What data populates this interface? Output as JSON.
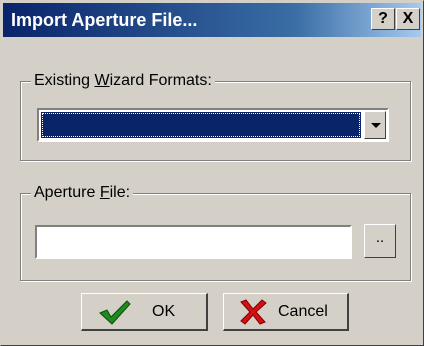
{
  "window": {
    "title": "Import Aperture File...",
    "help_glyph": "?",
    "close_glyph": "X"
  },
  "wizard_group": {
    "legend_prefix": "Existing ",
    "legend_accel": "W",
    "legend_suffix": "izard Formats:",
    "selected_value": ""
  },
  "aperture_group": {
    "legend_prefix": "Aperture ",
    "legend_accel": "F",
    "legend_suffix": "ile:",
    "value": "",
    "browse_label": ".."
  },
  "buttons": {
    "ok_label": "OK",
    "cancel_label": "Cancel"
  },
  "colors": {
    "title_bar": "#0a246a",
    "selection": "#0a246a",
    "face": "#d4d0c8",
    "ok_check": "#1f8a1f",
    "cancel_x": "#d41010"
  }
}
